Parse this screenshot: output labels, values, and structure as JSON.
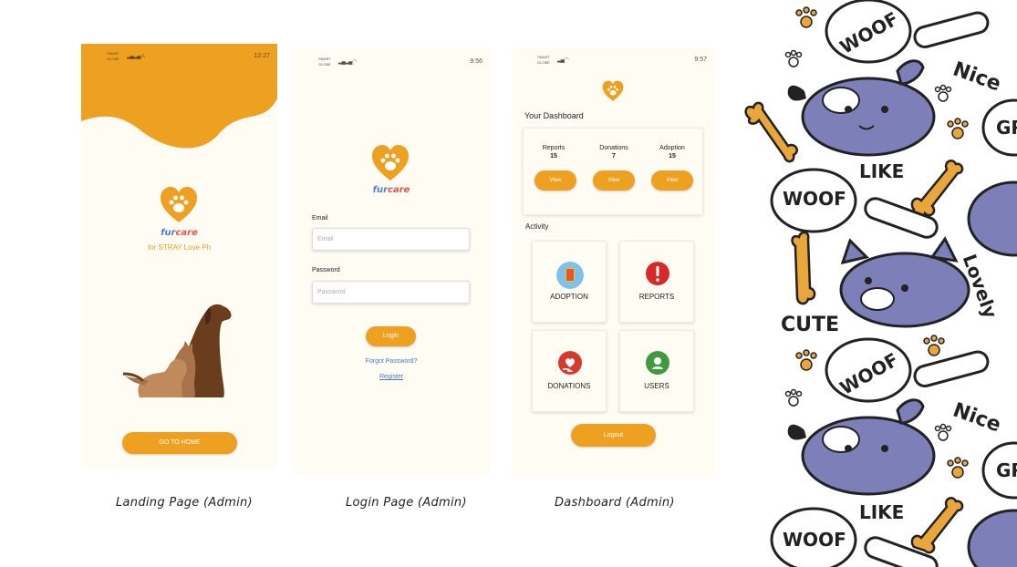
{
  "colors": {
    "accent": "#eea020",
    "background": "#fffcf3",
    "fur": "#4f7ec8",
    "care": "#e8534a"
  },
  "landing": {
    "status": {
      "carrier": "SMART GLOBE",
      "time": "12:27"
    },
    "brand_fur": "fur",
    "brand_care": "care",
    "tagline": "for STRAY Love Ph",
    "go_home_label": "GO TO HOME"
  },
  "login": {
    "status": {
      "carrier": "SMART GLOBE",
      "time": "9:56"
    },
    "brand_fur": "fur",
    "brand_care": "care",
    "email_label": "Email",
    "email_placeholder": "Email",
    "password_label": "Password",
    "password_placeholder": "Password",
    "login_label": "Login",
    "forgot_label": "Forgot Password?",
    "register_label": "Register"
  },
  "dashboard": {
    "status": {
      "carrier": "SMART GLOBE",
      "time": "9:57"
    },
    "title": "Your Dashboard",
    "stats": [
      {
        "label": "Reports",
        "value": "15",
        "button": "View"
      },
      {
        "label": "Donations",
        "value": "7",
        "button": "View"
      },
      {
        "label": "Adoption",
        "value": "15",
        "button": "View"
      }
    ],
    "activity_title": "Activity",
    "tiles": [
      {
        "label": "ADOPTION",
        "icon": "adoption-icon"
      },
      {
        "label": "REPORTS",
        "icon": "alert-icon"
      },
      {
        "label": "DONATIONS",
        "icon": "donation-icon"
      },
      {
        "label": "USERS",
        "icon": "users-icon"
      }
    ],
    "logout_label": "Logout"
  },
  "captions": {
    "landing": "Landing Page (Admin)",
    "login": "Login Page  (Admin)",
    "dashboard": "Dashboard  (Admin)"
  },
  "pattern": {
    "words": [
      "WOOF",
      "Nice",
      "LIKE",
      "WOOF",
      "CUTE",
      "Lovely",
      "WOOF",
      "Nice",
      "LIKE",
      "WOOF",
      "GR",
      "GR"
    ]
  }
}
